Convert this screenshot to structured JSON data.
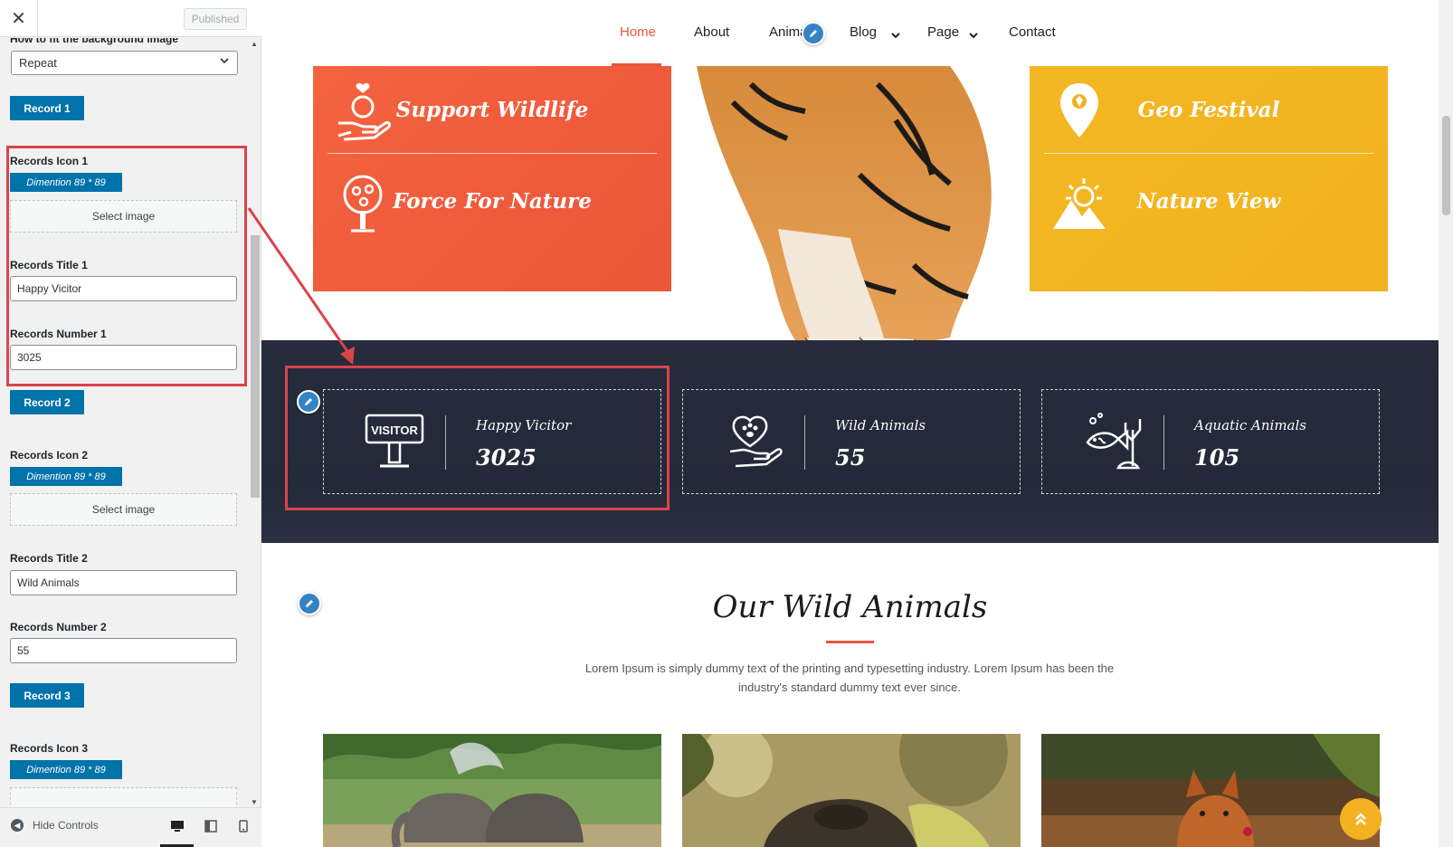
{
  "customizer": {
    "close_label": "✕",
    "published_label": "Published",
    "fit_label": "How to fit the background image",
    "fit_value": "Repeat",
    "records": [
      {
        "button": "Record 1",
        "icon_label": "Records Icon 1",
        "dimension": "Dimention 89 * 89",
        "select_image": "Select image",
        "title_label": "Records Title 1",
        "title_value": "Happy Vicitor",
        "number_label": "Records Number 1",
        "number_value": "3025"
      },
      {
        "button": "Record 2",
        "icon_label": "Records Icon 2",
        "dimension": "Dimention 89 * 89",
        "select_image": "Select image",
        "title_label": "Records Title 2",
        "title_value": "Wild Animals",
        "number_label": "Records Number 2",
        "number_value": "55"
      },
      {
        "button": "Record 3",
        "icon_label": "Records Icon 3",
        "dimension": "Dimention 89 * 89"
      }
    ],
    "footer": {
      "hide_controls": "Hide Controls",
      "devices": [
        "desktop-icon",
        "tablet-icon",
        "mobile-icon"
      ]
    }
  },
  "site": {
    "nav": [
      "Home",
      "About",
      "Anima",
      "Blog",
      "Page",
      "Contact"
    ],
    "features_left": [
      "Support Wildlife",
      "Force For Nature"
    ],
    "features_right": [
      "Geo Festival",
      "Nature View"
    ],
    "stats": [
      {
        "title": "Happy Vicitor",
        "number": "3025",
        "icon": "visitor-sign-icon",
        "icon_text": "VISITOR"
      },
      {
        "title": "Wild Animals",
        "number": "55",
        "icon": "paw-heart-hand-icon"
      },
      {
        "title": "Aquatic Animals",
        "number": "105",
        "icon": "fish-coral-icon"
      }
    ],
    "section_title": "Our Wild Animals",
    "section_desc": "Lorem Ipsum is simply dummy text of the printing and typesetting industry. Lorem Ipsum has been the industry's standard dummy text ever since.",
    "animals": [
      "elephants-photo",
      "bear-photo",
      "fox-photo"
    ]
  },
  "colors": {
    "accent_red": "#e8553c",
    "accent_yellow": "#f4b722",
    "wp_blue": "#0073aa",
    "highlight": "#d9434b",
    "stats_bg": "#252b3a"
  }
}
